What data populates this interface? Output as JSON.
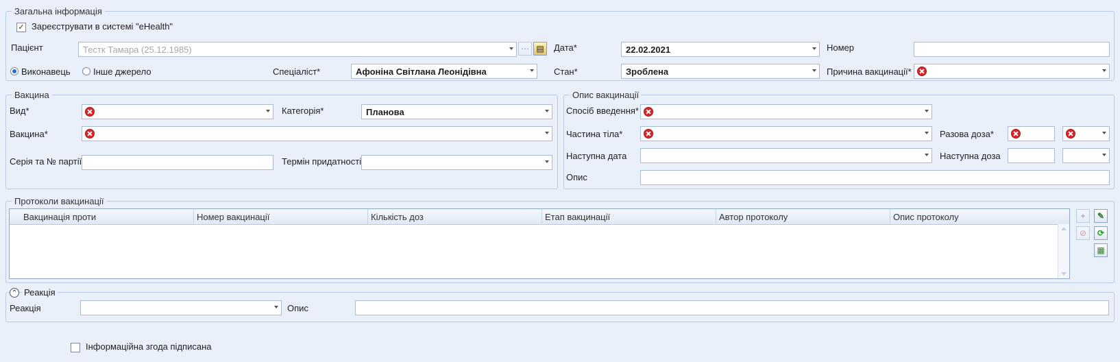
{
  "general": {
    "legend": "Загальна інформація",
    "ehealth_label": "Зареєструвати в системі \"eHealth\"",
    "ehealth_check": "✓",
    "patient_label": "Пацієнт",
    "patient_value": "Тестк Тамара  (25.12.1985)",
    "date_label": "Дата*",
    "date_value": "22.02.2021",
    "number_label": "Номер",
    "number_value": "",
    "performer_label": "Виконавець",
    "other_source_label": "Інше джерело",
    "specialist_label": "Спеціаліст*",
    "specialist_value": "Афоніна Світлана Леонідівна",
    "status_label": "Стан*",
    "status_value": "Зроблена",
    "reason_label": "Причина вакцинації*"
  },
  "vaccine": {
    "legend": "Вакцина",
    "type_label": "Вид*",
    "category_label": "Категорія*",
    "category_value": "Планова",
    "vaccine_label": "Вакцина*",
    "series_label": "Серія та № партії",
    "expiry_label": "Термін придатності"
  },
  "description": {
    "legend": "Опис вакцинації",
    "route_label": "Спосіб введення*",
    "body_part_label": "Частина тіла*",
    "single_dose_label": "Разова доза*",
    "next_date_label": "Наступна дата",
    "next_dose_label": "Наступна доза",
    "desc_label": "Опис"
  },
  "protocols": {
    "legend": "Протоколи вакцинації",
    "columns": [
      "Вакцинація проти",
      "Номер вакцинації",
      "Кількість доз",
      "Етап вакцинації",
      "Автор протоколу",
      "Опис протоколу"
    ]
  },
  "reaction": {
    "legend": "Реакція",
    "collapse_glyph": "⌃",
    "reaction_label": "Реакція",
    "desc_label": "Опис"
  },
  "consent_label": "Інформаційна згода підписана",
  "icons": {
    "add": "+",
    "edit": "✎",
    "delete": "⊘",
    "refresh": "⟳",
    "export": "▦",
    "lookup": "⋯",
    "folder": "▤"
  },
  "colors": {
    "background": "#e9f0fa",
    "error": "#d9262a",
    "border": "#a9bad2"
  }
}
